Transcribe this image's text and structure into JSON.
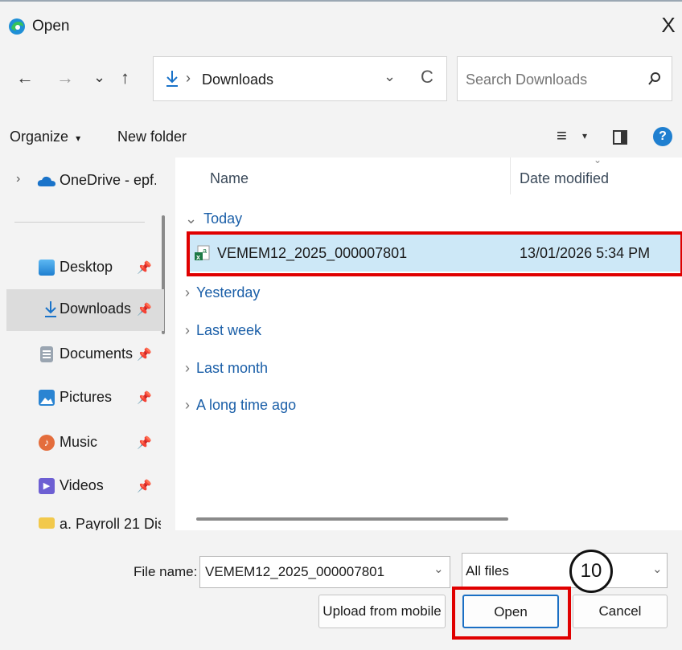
{
  "window": {
    "title": "Open",
    "close_glyph": "X"
  },
  "nav": {
    "back": "←",
    "forward": "→",
    "recent": "⌄",
    "up": "↑",
    "refresh": "C",
    "dropdown": "⌄"
  },
  "address": {
    "separator": "›",
    "location": "Downloads"
  },
  "search": {
    "placeholder": "Search Downloads",
    "icon": "search-icon"
  },
  "toolbar": {
    "organize": "Organize",
    "organize_caret": "▾",
    "new_folder": "New folder",
    "view_menu": "≡",
    "view_caret": "▾",
    "help": "?"
  },
  "sidebar": {
    "onedrive": "OneDrive - epf.g",
    "items": [
      {
        "label": "Desktop",
        "icon": "desktop-icon",
        "color": "#2f8fd8"
      },
      {
        "label": "Downloads",
        "icon": "download-icon",
        "selected": true
      },
      {
        "label": "Documents",
        "icon": "documents-icon",
        "color": "#9aa5b1"
      },
      {
        "label": "Pictures",
        "icon": "pictures-icon",
        "color": "#2a84d2"
      },
      {
        "label": "Music",
        "icon": "music-icon",
        "color": "#e46d3c"
      },
      {
        "label": "Videos",
        "icon": "videos-icon",
        "color": "#6d5fd3"
      }
    ],
    "partial_folder": "a. Payroll 21 Dis"
  },
  "columns": {
    "name": "Name",
    "date": "Date modified"
  },
  "groups": {
    "today": "Today",
    "yesterday": "Yesterday",
    "last_week": "Last week",
    "last_month": "Last month",
    "long_ago": "A long time ago"
  },
  "file": {
    "name": "VEMEM12_2025_000007801",
    "date": "13/01/2026 5:34 PM"
  },
  "bottom": {
    "file_name_label": "File name:",
    "file_name_value": "VEMEM12_2025_000007801",
    "file_type": "All files",
    "upload_button": "Upload from mobile",
    "open_button": "Open",
    "cancel_button": "Cancel"
  },
  "annotation": {
    "step": "10",
    "color": "#e00000"
  }
}
